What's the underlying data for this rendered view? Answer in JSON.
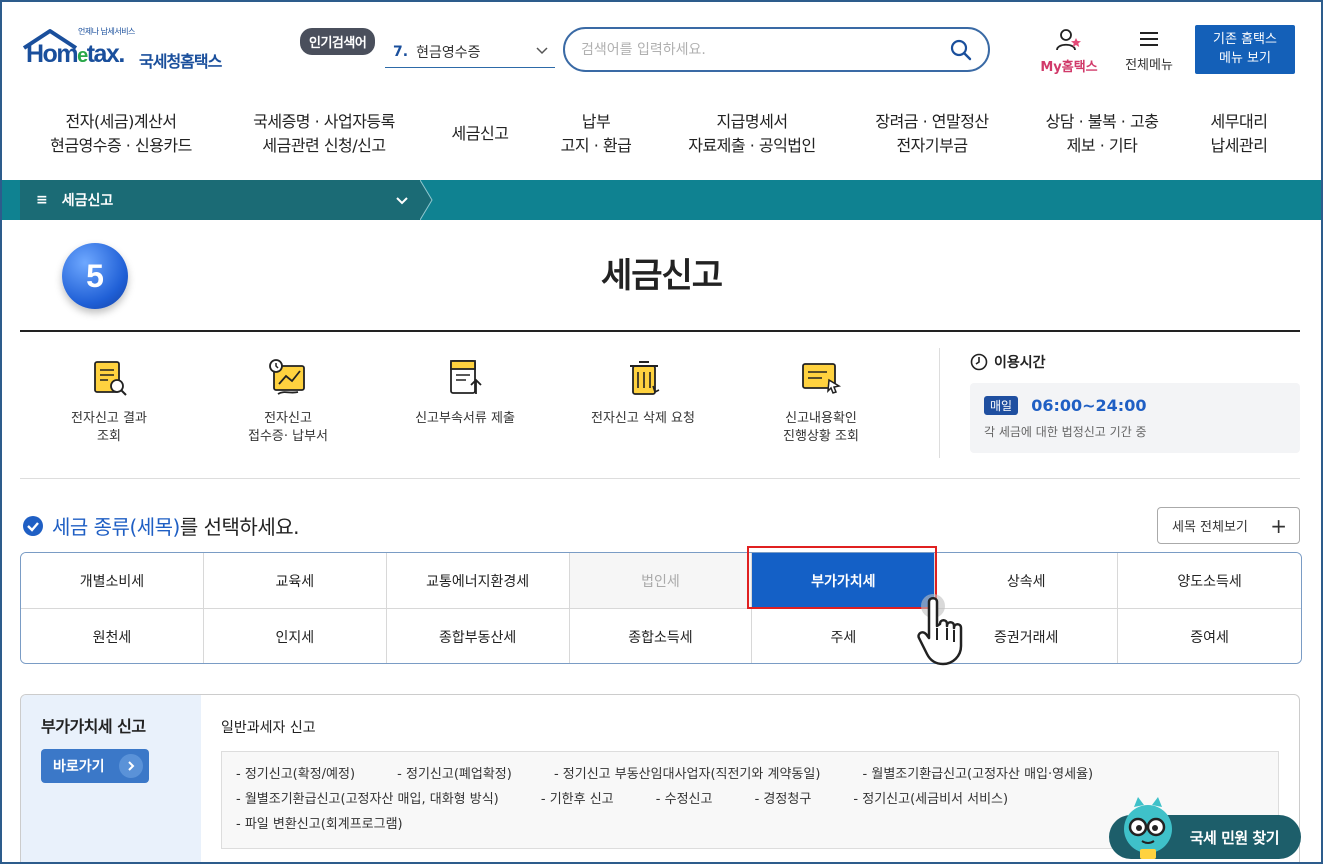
{
  "header": {
    "logo_small": "언제나 납세서비스",
    "logo_main_1": "Hom",
    "logo_main_e": "e",
    "logo_main_2": "tax.",
    "logo_kr": "국세청홈택스",
    "popular_label": "인기검색어",
    "popular_rank": "7.",
    "popular_term": "현금영수증",
    "search_placeholder": "검색어를 입력하세요.",
    "my_hometax": "My홈택스",
    "all_menu": "전체메뉴",
    "old_menu_line1": "기존 홈택스",
    "old_menu_line2": "메뉴 보기"
  },
  "nav": [
    {
      "line1": "전자(세금)계산서",
      "line2": "현금영수증 · 신용카드"
    },
    {
      "line1": "국세증명 · 사업자등록",
      "line2": "세금관련 신청/신고"
    },
    {
      "line1": "세금신고",
      "line2": ""
    },
    {
      "line1": "납부",
      "line2": "고지 · 환급"
    },
    {
      "line1": "지급명세서",
      "line2": "자료제출 · 공익법인"
    },
    {
      "line1": "장려금 · 연말정산",
      "line2": "전자기부금"
    },
    {
      "line1": "상담 · 불복 · 고충",
      "line2": "제보 · 기타"
    },
    {
      "line1": "세무대리",
      "line2": "납세관리"
    }
  ],
  "breadcrumb": {
    "label": "세금신고"
  },
  "page": {
    "step": "5",
    "title": "세금신고"
  },
  "quick_links": [
    {
      "line1": "전자신고 결과",
      "line2": "조회"
    },
    {
      "line1": "전자신고",
      "line2": "접수증· 납부서"
    },
    {
      "line1": "신고부속서류 제출",
      "line2": ""
    },
    {
      "line1": "전자신고 삭제 요청",
      "line2": ""
    },
    {
      "line1": "신고내용확인",
      "line2": "진행상황 조회"
    }
  ],
  "hours": {
    "title": "이용시간",
    "badge": "매일",
    "time": "06:00~24:00",
    "desc": "각 세금에 대한 법정신고 기간 중"
  },
  "tax_select": {
    "heading_highlight": "세금 종류(세목)",
    "heading_rest": "를 선택하세요.",
    "all_button": "세목 전체보기",
    "items": [
      "개별소비세",
      "교육세",
      "교통에너지환경세",
      "법인세",
      "부가가치세",
      "상속세",
      "양도소득세",
      "원천세",
      "인지세",
      "종합부동산세",
      "종합소득세",
      "주세",
      "증권거래세",
      "증여세"
    ],
    "active": "부가가치세",
    "disabled": "법인세"
  },
  "vat_panel": {
    "title": "부가가치세 신고",
    "goto_button": "바로가기",
    "subtitle": "일반과세자 신고",
    "items": [
      "- 정기신고(확정/예정)",
      "- 정기신고(폐업확정)",
      "- 정기신고 부동산임대사업자(직전기와 계약동일)",
      "- 월별조기환급신고(고정자산 매입·영세율)",
      "- 월별조기환급신고(고정자산 매입, 대화형 방식)",
      "- 기한후 신고",
      "- 수정신고",
      "- 경정청구",
      "- 정기신고(세금비서 서비스)",
      "- 파일 변환신고(회계프로그램)"
    ]
  },
  "civil_button": "국세 민원 찾기",
  "colors": {
    "brand_blue": "#1460c6",
    "teal_bar": "#0f8291",
    "highlight_red": "#e02020"
  }
}
